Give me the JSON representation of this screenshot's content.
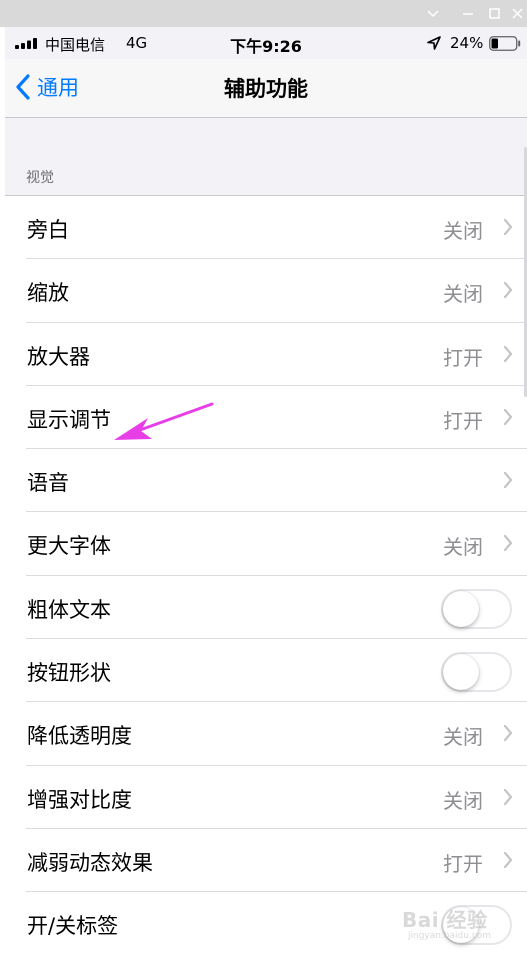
{
  "window": {
    "buttons": [
      "minimize",
      "maximize",
      "close"
    ]
  },
  "status_bar": {
    "carrier": "中国电信",
    "network": "4G",
    "time": "下午9:26",
    "battery": "24%"
  },
  "nav": {
    "back_label": "通用",
    "title": "辅助功能"
  },
  "section": {
    "header": "视觉"
  },
  "rows": [
    {
      "label": "旁白",
      "value": "关闭",
      "control": "chevron"
    },
    {
      "label": "缩放",
      "value": "关闭",
      "control": "chevron"
    },
    {
      "label": "放大器",
      "value": "打开",
      "control": "chevron"
    },
    {
      "label": "显示调节",
      "value": "打开",
      "control": "chevron"
    },
    {
      "label": "语音",
      "value": "",
      "control": "chevron"
    },
    {
      "label": "更大字体",
      "value": "关闭",
      "control": "chevron"
    },
    {
      "label": "粗体文本",
      "value": "",
      "control": "toggle",
      "on": false
    },
    {
      "label": "按钮形状",
      "value": "",
      "control": "toggle",
      "on": false
    },
    {
      "label": "降低透明度",
      "value": "关闭",
      "control": "chevron"
    },
    {
      "label": "增强对比度",
      "value": "关闭",
      "control": "chevron"
    },
    {
      "label": "减弱动态效果",
      "value": "打开",
      "control": "chevron"
    },
    {
      "label": "开/关标签",
      "value": "",
      "control": "toggle",
      "on": false
    }
  ],
  "colors": {
    "accent": "#007aff",
    "annotation": "#e83ee8",
    "secondary_text": "#8e8e93"
  },
  "watermark": {
    "text": "Bai 经验",
    "sub": "jingyan.baidu.com"
  }
}
